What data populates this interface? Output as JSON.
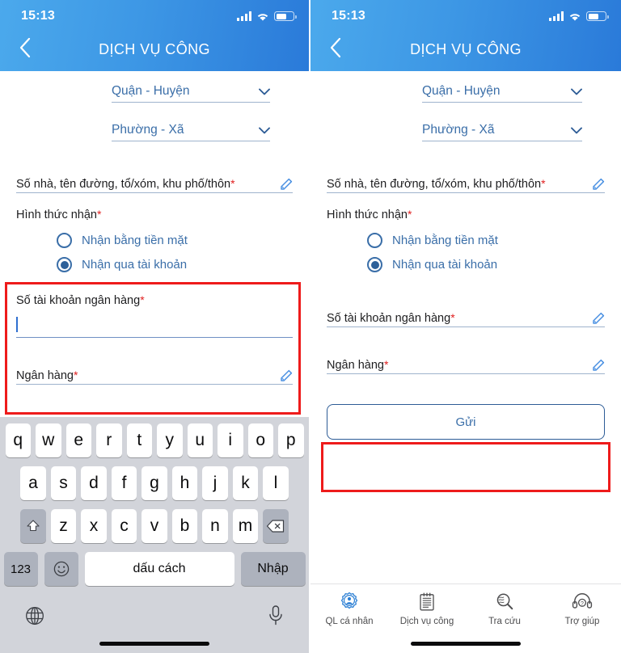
{
  "statusbar": {
    "time": "15:13",
    "signal_icon": "cellular-bars-icon",
    "wifi_icon": "wifi-icon",
    "battery_icon": "battery-icon"
  },
  "header": {
    "title": "DỊCH VỤ CÔNG",
    "back_icon": "chevron-left-icon",
    "gradient_from": "#4ba9ec",
    "gradient_to": "#2a7ad9"
  },
  "colors": {
    "accent_blue": "#3a6ea8",
    "link_blue": "#2d6099",
    "required_red": "#e02020",
    "highlight_red": "#ee1b1b",
    "underline": "#9fb3cd",
    "keyboard_bg": "#d2d4da"
  },
  "form": {
    "district_select": {
      "label": "Quận - Huyện",
      "icon": "chevron-down-icon"
    },
    "ward_select": {
      "label": "Phường - Xã",
      "icon": "chevron-down-icon"
    },
    "address_field": {
      "label": "Số nhà, tên đường, tổ/xóm, khu phố/thôn",
      "required_mark": "*",
      "icon": "pencil-icon",
      "value": ""
    },
    "receive_method": {
      "label": "Hình thức nhận",
      "required_mark": "*",
      "options": [
        {
          "label": "Nhận bằng tiền mặt",
          "selected": false
        },
        {
          "label": "Nhận qua tài khoản",
          "selected": true
        }
      ]
    },
    "bank_account_field": {
      "label": "Số tài khoản ngân hàng",
      "required_mark": "*",
      "icon": "pencil-icon",
      "value": ""
    },
    "bank_field": {
      "label": "Ngân hàng",
      "required_mark": "*",
      "icon": "pencil-icon",
      "value": ""
    },
    "submit_button": {
      "label": "Gửi"
    }
  },
  "keyboard": {
    "row1": [
      "q",
      "w",
      "e",
      "r",
      "t",
      "y",
      "u",
      "i",
      "o",
      "p"
    ],
    "row2": [
      "a",
      "s",
      "d",
      "f",
      "g",
      "h",
      "j",
      "k",
      "l"
    ],
    "row3": [
      "z",
      "x",
      "c",
      "v",
      "b",
      "n",
      "m"
    ],
    "shift_icon": "shift-up-arrow-icon",
    "backspace_icon": "backspace-delete-icon",
    "numbers_key": "123",
    "emoji_icon": "smiley-face-icon",
    "space_key": "dấu cách",
    "enter_key": "Nhập",
    "globe_icon": "globe-language-icon",
    "mic_icon": "microphone-icon"
  },
  "tabbar": {
    "items": [
      {
        "label": "QL cá nhân",
        "icon": "person-gear-badge-icon",
        "active": true
      },
      {
        "label": "Dịch vụ công",
        "icon": "document-list-icon",
        "active": false
      },
      {
        "label": "Tra cứu",
        "icon": "magnifier-search-icon",
        "active": false
      },
      {
        "label": "Trợ giúp",
        "icon": "headset-support-icon",
        "active": false
      }
    ]
  },
  "annotations": {
    "left_highlight": "bank-details-highlight-box",
    "right_highlight": "submit-button-highlight-box"
  }
}
